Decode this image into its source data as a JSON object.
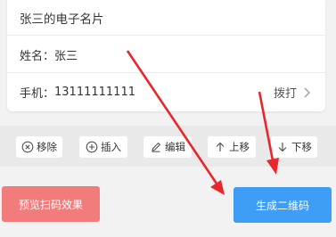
{
  "card": {
    "title": "张三的电子名片",
    "name_label": "姓名：",
    "name_value": "张三",
    "phone_label": "手机：",
    "phone_value": "13111111111",
    "dial_label": "拨打"
  },
  "toolbar": {
    "remove_label": "移除",
    "insert_label": "插入",
    "edit_label": "编辑",
    "move_up_label": "上移",
    "move_down_label": "下移"
  },
  "actions": {
    "preview_label": "预览扫码效果",
    "generate_label": "生成二维码"
  },
  "colors": {
    "preview_button": "#f27b7b",
    "generate_button": "#3e9df5",
    "annotation_arrow": "#e8262c"
  }
}
